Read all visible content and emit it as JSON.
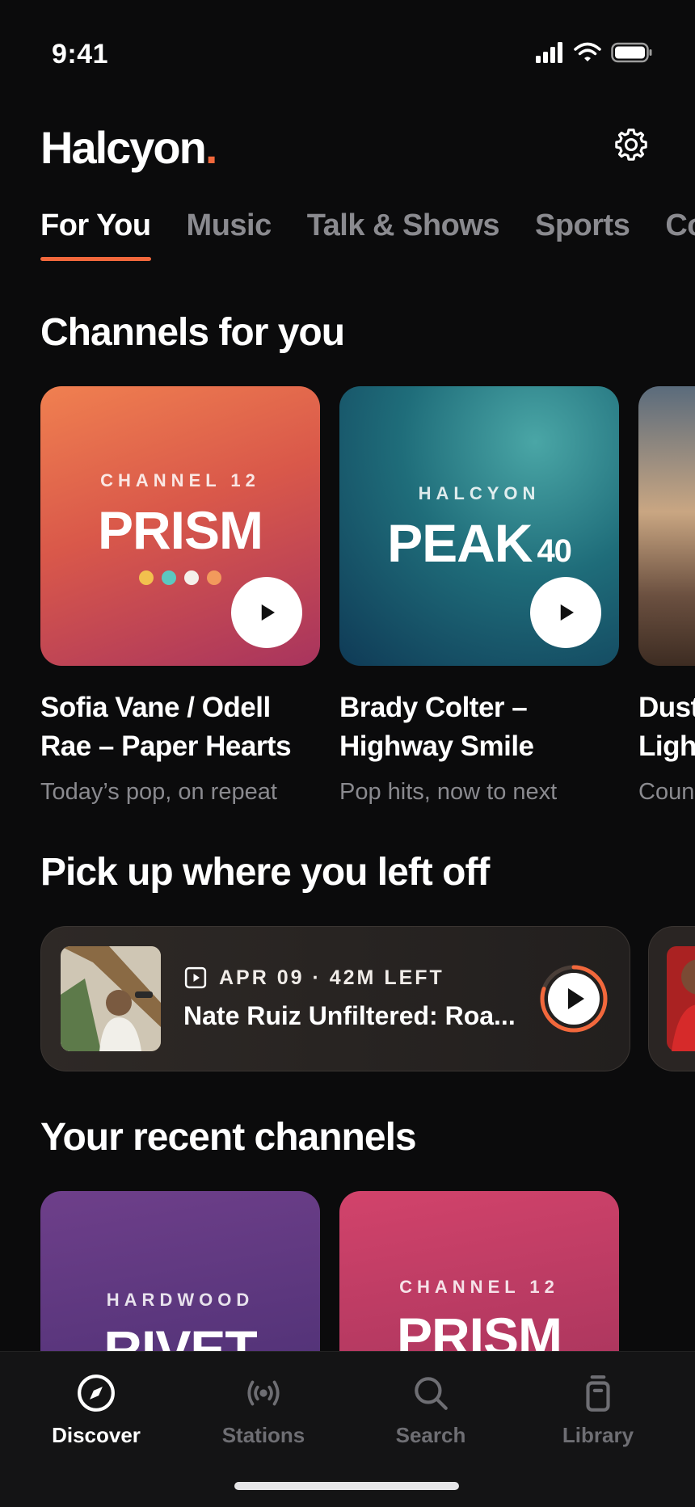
{
  "status": {
    "time": "9:41"
  },
  "app": {
    "logo_text": "Halcyon",
    "logo_dot": ".",
    "accent": "#f2683c"
  },
  "tabs": [
    {
      "label": "For You",
      "active": true
    },
    {
      "label": "Music"
    },
    {
      "label": "Talk & Shows"
    },
    {
      "label": "Sports"
    },
    {
      "label": "Co"
    }
  ],
  "channels_section": {
    "title": "Channels for you",
    "cards": [
      {
        "kicker": "CHANNEL 12",
        "name": "PRISM",
        "title": "Sofia Vane / Odell Rae – Paper Hearts",
        "subtitle": "Today’s pop, on repeat",
        "dot_colors": [
          "#f2c14e",
          "#5cc8c0",
          "#f4f0ea",
          "#f29a5c"
        ]
      },
      {
        "kicker": "HALCYON",
        "name": "PEAK",
        "number": "40",
        "title": "Brady Colter – Highway Smile",
        "subtitle": "Pop hits, now to next"
      },
      {
        "title": "Dust Ligh",
        "subtitle": "Coun"
      }
    ]
  },
  "continue_section": {
    "title": "Pick up where you left off",
    "item": {
      "meta": "APR 09 · 42M LEFT",
      "title": "Nate Ruiz Unfiltered: Roa...",
      "progress": 0.8
    }
  },
  "recent_section": {
    "title": "Your recent channels",
    "cards": [
      {
        "kicker": "HARDWOOD",
        "name": "RIVET"
      },
      {
        "kicker": "CHANNEL 12",
        "name": "PRISM"
      }
    ]
  },
  "bottom_nav": [
    {
      "label": "Discover",
      "icon": "compass-icon",
      "active": true
    },
    {
      "label": "Stations",
      "icon": "broadcast-icon"
    },
    {
      "label": "Search",
      "icon": "search-icon"
    },
    {
      "label": "Library",
      "icon": "library-icon"
    }
  ]
}
